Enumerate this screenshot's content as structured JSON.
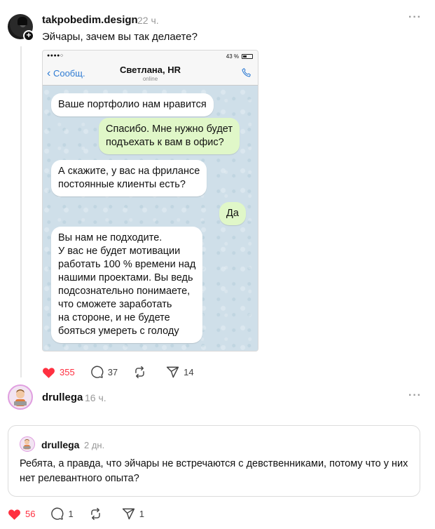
{
  "post": {
    "username": "takpobedim.design",
    "time": "22 ч.",
    "text": "Эйчары, зачем вы так делаете?",
    "more_icon": "more-horizontal-icon",
    "stats": {
      "likes": "355",
      "replies": "37",
      "reposts": "",
      "shares": "14"
    }
  },
  "phone": {
    "signal": "●●●●○",
    "battery": "43 %",
    "back_label": "Сообщ.",
    "chat_name": "Светлана, HR",
    "chat_status": "online",
    "messages": [
      {
        "from": "in",
        "text": "Ваше портфолио нам нравится"
      },
      {
        "from": "out",
        "text": "Спасибо. Мне нужно будет\nподъехать к вам в офис?"
      },
      {
        "from": "in",
        "text": "А скажите, у вас на фрилансе\nпостоянные клиенты есть?"
      },
      {
        "from": "out",
        "text": "Да"
      },
      {
        "from": "in",
        "text": "Вы нам не подходите.\nУ вас не будет мотивации\nработать 100 % времени над\nнашими проектами. Вы ведь\nподсознательно понимаете,\nчто сможете заработать\nна стороне, и не будете\nбояться умереть с голоду"
      }
    ]
  },
  "reply": {
    "username": "drullega",
    "time": "16 ч.",
    "quoted": {
      "username": "drullega",
      "time": "2 дн.",
      "text": "Ребята, а правда, что эйчары не встречаются с девственниками, потому что у них нет релевантного опыта?"
    },
    "stats": {
      "likes": "56",
      "replies": "1",
      "reposts": "",
      "shares": "1"
    }
  },
  "colors": {
    "like": "#ff3040",
    "muted": "#999999",
    "link_blue": "#2e7bd3",
    "out_bubble": "#e0f7c8"
  }
}
